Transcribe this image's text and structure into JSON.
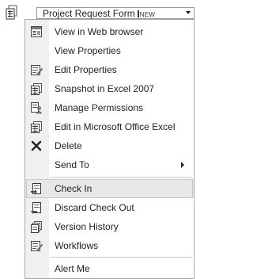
{
  "document": {
    "icon": "excel-document-icon",
    "title": "Project Request Form",
    "badge": "NEW"
  },
  "menu": {
    "items": [
      {
        "label": "View in Web browser",
        "icon": "web-page-icon"
      },
      {
        "label": "View Properties",
        "icon": ""
      },
      {
        "label": "Edit Properties",
        "icon": "edit-properties-icon"
      },
      {
        "label": "Snapshot in Excel 2007",
        "icon": "excel-snapshot-icon"
      },
      {
        "label": "Manage Permissions",
        "icon": "permissions-icon"
      },
      {
        "label": "Edit in Microsoft Office Excel",
        "icon": "excel-edit-icon"
      },
      {
        "label": "Delete",
        "icon": "delete-x-icon"
      },
      {
        "label": "Send To",
        "icon": "",
        "submenu": true
      },
      {
        "label": "Check In",
        "icon": "check-in-icon",
        "selected": true
      },
      {
        "label": "Discard Check Out",
        "icon": "discard-checkout-icon"
      },
      {
        "label": "Version History",
        "icon": "version-history-icon"
      },
      {
        "label": "Workflows",
        "icon": "workflows-icon"
      },
      {
        "label": "Alert Me",
        "icon": ""
      }
    ]
  }
}
